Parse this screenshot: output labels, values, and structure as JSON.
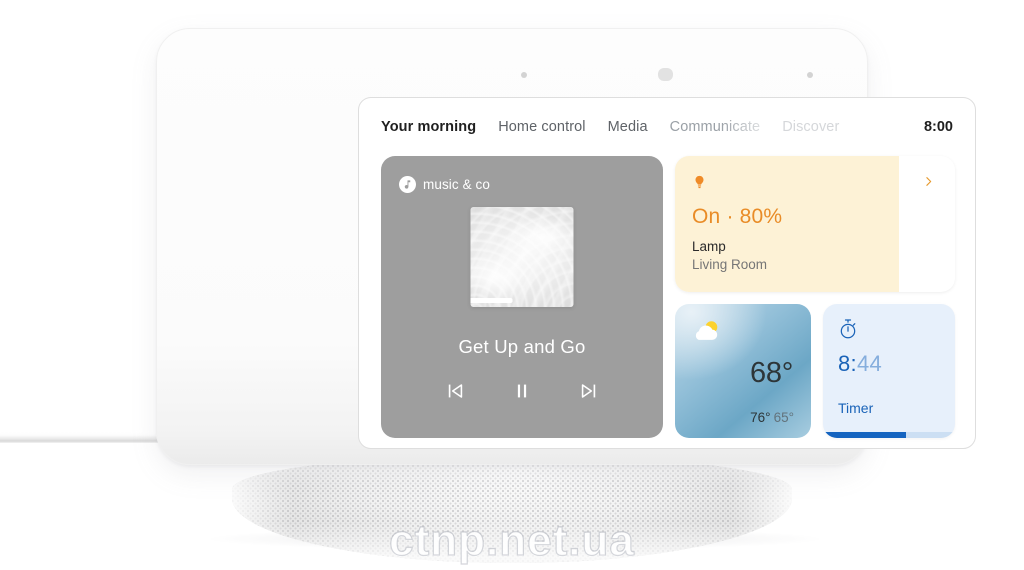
{
  "device": {
    "name": "smart-display",
    "sensors": [
      "ambient-light-sensor-left",
      "camera-sensor",
      "ambient-light-sensor-right"
    ]
  },
  "nav": {
    "tabs": [
      {
        "label": "Your morning",
        "state": "active"
      },
      {
        "label": "Home control",
        "state": "idle"
      },
      {
        "label": "Media",
        "state": "idle"
      },
      {
        "label": "Communicate",
        "state": "fade"
      },
      {
        "label": "Discover",
        "state": "dim"
      }
    ],
    "clock": "8:00"
  },
  "music_card": {
    "provider": "music & co",
    "provider_icon": "music-note-icon",
    "title": "Get Up and Go",
    "album_art": "water-ripple-artwork",
    "album_progress_percent": 41,
    "controls": [
      {
        "name": "previous-track-button",
        "icon": "skip-previous-icon"
      },
      {
        "name": "play-pause-button",
        "icon": "pause-icon"
      },
      {
        "name": "next-track-button",
        "icon": "skip-next-icon"
      }
    ]
  },
  "lamp_card": {
    "icon": "light-bulb-icon",
    "state": "On · 80%",
    "brightness_percent": 80,
    "name": "Lamp",
    "room": "Living Room",
    "chevron": "chevron-right-icon",
    "accent_color": "#e98c27",
    "background_color": "#fdf2d6"
  },
  "weather_card": {
    "icon": "partly-cloudy-icon",
    "temperature": "68°",
    "high": "76°",
    "low": "65°"
  },
  "timer_card": {
    "icon": "stopwatch-icon",
    "time_minutes": "8:",
    "time_seconds": "44",
    "label": "Timer",
    "progress_percent": 63,
    "accent_color": "#1564c0",
    "background_color": "#e7f0fb"
  },
  "watermark": {
    "text": "ctnp.net.ua"
  }
}
